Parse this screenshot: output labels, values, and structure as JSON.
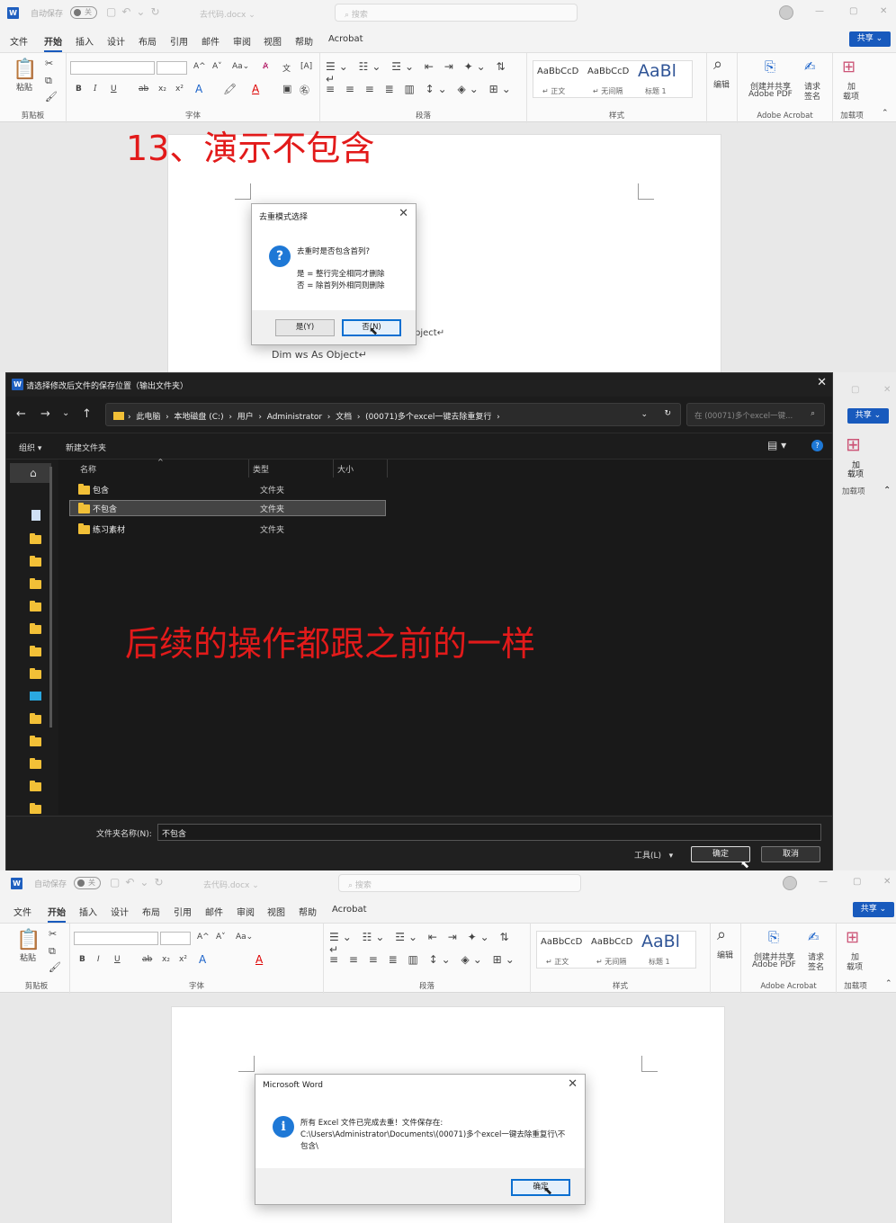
{
  "word_ui": {
    "autosave_label": "自动保存",
    "autosave_state": "关",
    "doc_name": "去代码.docx ⌄",
    "search_placeholder": "搜索",
    "menu": [
      "文件",
      "开始",
      "插入",
      "设计",
      "布局",
      "引用",
      "邮件",
      "审阅",
      "视图",
      "帮助",
      "Acrobat"
    ],
    "share_label": "共享 ⌄",
    "ribbon": {
      "clipboard": {
        "paste": "粘贴",
        "label": "剪贴板"
      },
      "font": {
        "label": "字体",
        "grow": "A^",
        "shrink": "A˅",
        "aa": "Aa⌄",
        "bold": "B",
        "italic": "I",
        "underline": "U",
        "strike": "ab",
        "sub": "x₂",
        "sup": "x²"
      },
      "paragraph": {
        "label": "段落"
      },
      "styles": {
        "label": "样式",
        "normal_preview": "AaBbCcD",
        "normal_name": "↵ 正文",
        "nospace_preview": "AaBbCcD",
        "nospace_name": "↵ 无间隔",
        "heading_preview": "AaBl",
        "heading_name": "标题 1"
      },
      "editing": {
        "label": "编辑"
      },
      "acrobat": {
        "create_share_1": "创建并共享",
        "create_share_2": "Adobe PDF",
        "sign_1": "请求",
        "sign_2": "签名",
        "label": "Adobe Acrobat"
      },
      "addins": {
        "add_1": "加",
        "add_2": "载项",
        "label": "加载项"
      }
    }
  },
  "annotation_top": "13、演示不包含",
  "dialog_mode": {
    "title": "去重模式选择",
    "question": "去重时是否包含首列?",
    "line_yes": "是 = 整行完全相同才删除",
    "line_no": "否 = 除首列外相同则删除",
    "yes_button": "是(Y)",
    "no_button": "否(N)"
  },
  "doc_text_1": "Dim ws As Object↵",
  "doc_text_1_partial": "bject↵",
  "folder_dialog": {
    "title": "请选择修改后文件的保存位置（输出文件夹）",
    "address": [
      "此电脑",
      "本地磁盘 (C:)",
      "用户",
      "Administrator",
      "文档",
      "(00071)多个excel一键去除重复行"
    ],
    "search_placeholder": "在 (00071)多个excel一键...",
    "organize": "组织 ▾",
    "new_folder": "新建文件夹",
    "columns": [
      "名称",
      "类型",
      "大小"
    ],
    "rows": [
      {
        "name": "包含",
        "type": "文件夹"
      },
      {
        "name": "不包含",
        "type": "文件夹"
      },
      {
        "name": "练习素材",
        "type": "文件夹"
      }
    ],
    "folder_label": "文件夹名称(N):",
    "folder_value": "不包含",
    "tools": "工具(L)",
    "ok": "确定",
    "cancel": "取消"
  },
  "annotation_mid": "后续的操作都跟之前的一样",
  "side_share": "共享 ⌄",
  "side_addins_1": "加",
  "side_addins_2": "载项",
  "side_addins_label": "加载项",
  "dialog_done": {
    "title": "Microsoft Word",
    "line1": "所有 Excel 文件已完成去重！文件保存在:",
    "line2": "C:\\Users\\Administrator\\Documents\\(00071)多个excel一键去除重复行\\不",
    "line3": "包含\\",
    "ok": "确定"
  }
}
